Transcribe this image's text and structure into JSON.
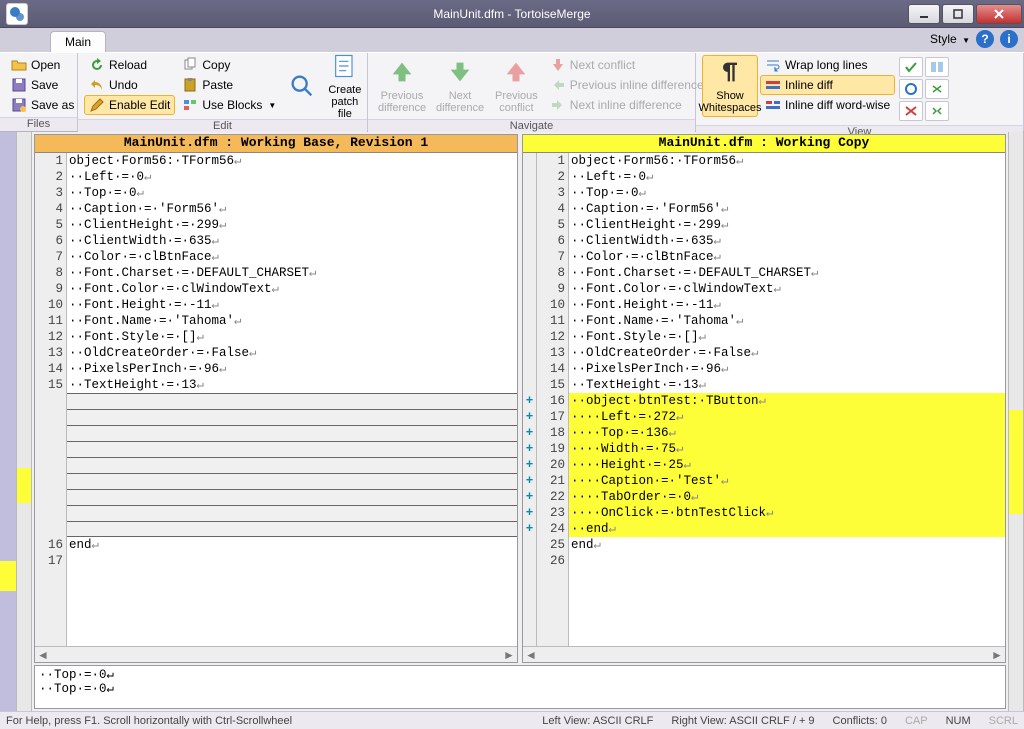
{
  "title": "MainUnit.dfm - TortoiseMerge",
  "tab": "Main",
  "style_label": "Style",
  "ribbon": {
    "files": {
      "open": "Open",
      "save": "Save",
      "saveas": "Save as",
      "label": "Files"
    },
    "edit": {
      "reload": "Reload",
      "undo": "Undo",
      "enable_edit": "Enable Edit",
      "copy": "Copy",
      "paste": "Paste",
      "use_blocks": "Use Blocks",
      "create_patch": "Create\npatch file",
      "label": "Edit"
    },
    "navigate": {
      "prev_diff": "Previous\ndifference",
      "next_diff": "Next\ndifference",
      "prev_conflict": "Previous\nconflict",
      "next_conflict": "Next conflict",
      "prev_inline": "Previous inline difference",
      "next_inline": "Next inline difference",
      "label": "Navigate"
    },
    "view": {
      "whitespaces": "Show\nWhitespaces",
      "wrap": "Wrap long lines",
      "inline_diff": "Inline diff",
      "inline_word": "Inline diff word-wise",
      "label": "View"
    }
  },
  "panes": {
    "base_title": "MainUnit.dfm : Working Base, Revision 1",
    "working_title": "MainUnit.dfm : Working Copy"
  },
  "base_lines": [
    {
      "n": 1,
      "t": "object·Form56:·TForm56"
    },
    {
      "n": 2,
      "t": "··Left·=·0"
    },
    {
      "n": 3,
      "t": "··Top·=·0"
    },
    {
      "n": 4,
      "t": "··Caption·=·'Form56'"
    },
    {
      "n": 5,
      "t": "··ClientHeight·=·299"
    },
    {
      "n": 6,
      "t": "··ClientWidth·=·635"
    },
    {
      "n": 7,
      "t": "··Color·=·clBtnFace"
    },
    {
      "n": 8,
      "t": "··Font.Charset·=·DEFAULT_CHARSET"
    },
    {
      "n": 9,
      "t": "··Font.Color·=·clWindowText"
    },
    {
      "n": 10,
      "t": "··Font.Height·=·-11"
    },
    {
      "n": 11,
      "t": "··Font.Name·=·'Tahoma'"
    },
    {
      "n": 12,
      "t": "··Font.Style·=·[]"
    },
    {
      "n": 13,
      "t": "··OldCreateOrder·=·False"
    },
    {
      "n": 14,
      "t": "··PixelsPerInch·=·96"
    },
    {
      "n": 15,
      "t": "··TextHeight·=·13"
    },
    {
      "n": 16,
      "t": "end",
      "skip": "after"
    },
    {
      "n": 17,
      "t": ""
    }
  ],
  "work_lines": [
    {
      "n": 1,
      "t": "object·Form56:·TForm56"
    },
    {
      "n": 2,
      "t": "··Left·=·0"
    },
    {
      "n": 3,
      "t": "··Top·=·0"
    },
    {
      "n": 4,
      "t": "··Caption·=·'Form56'"
    },
    {
      "n": 5,
      "t": "··ClientHeight·=·299"
    },
    {
      "n": 6,
      "t": "··ClientWidth·=·635"
    },
    {
      "n": 7,
      "t": "··Color·=·clBtnFace"
    },
    {
      "n": 8,
      "t": "··Font.Charset·=·DEFAULT_CHARSET"
    },
    {
      "n": 9,
      "t": "··Font.Color·=·clWindowText"
    },
    {
      "n": 10,
      "t": "··Font.Height·=·-11"
    },
    {
      "n": 11,
      "t": "··Font.Name·=·'Tahoma'"
    },
    {
      "n": 12,
      "t": "··Font.Style·=·[]"
    },
    {
      "n": 13,
      "t": "··OldCreateOrder·=·False"
    },
    {
      "n": 14,
      "t": "··PixelsPerInch·=·96"
    },
    {
      "n": 15,
      "t": "··TextHeight·=·13"
    },
    {
      "n": 16,
      "t": "··object·btnTest:·TButton",
      "m": "+",
      "c": "added"
    },
    {
      "n": 17,
      "t": "····Left·=·272",
      "m": "+",
      "c": "added"
    },
    {
      "n": 18,
      "t": "····Top·=·136",
      "m": "+",
      "c": "added"
    },
    {
      "n": 19,
      "t": "····Width·=·75",
      "m": "+",
      "c": "added"
    },
    {
      "n": 20,
      "t": "····Height·=·25",
      "m": "+",
      "c": "added"
    },
    {
      "n": 21,
      "t": "····Caption·=·'Test'",
      "m": "+",
      "c": "added"
    },
    {
      "n": 22,
      "t": "····TabOrder·=·0",
      "m": "+",
      "c": "added"
    },
    {
      "n": 23,
      "t": "····OnClick·=·btnTestClick",
      "m": "+",
      "c": "added"
    },
    {
      "n": 24,
      "t": "··end",
      "m": "+",
      "c": "added"
    },
    {
      "n": 25,
      "t": "end"
    },
    {
      "n": 26,
      "t": ""
    }
  ],
  "bottom_lines": [
    "··Top·=·0↵",
    "··Top·=·0↵"
  ],
  "status": {
    "help": "For Help, press F1. Scroll horizontally with Ctrl-Scrollwheel",
    "left": "Left View: ASCII CRLF",
    "right": "Right View: ASCII CRLF  / + 9",
    "conflicts": "Conflicts: 0",
    "cap": "CAP",
    "num": "NUM",
    "scrl": "SCRL"
  }
}
